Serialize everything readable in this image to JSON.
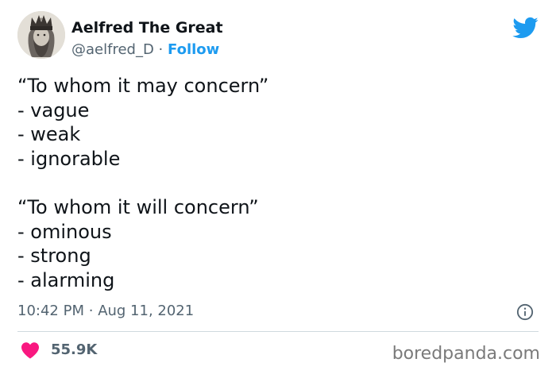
{
  "author": {
    "display_name": "Aelfred The Great",
    "handle": "@aelfred_D",
    "separator": "·",
    "follow_label": "Follow"
  },
  "tweet": {
    "text": "“To whom it may concern”\n- vague\n- weak\n- ignorable\n\n“To whom it will concern”\n- ominous\n- strong\n- alarming",
    "time": "10:42 PM",
    "separator": "·",
    "date": "Aug 11, 2021"
  },
  "engagement": {
    "likes": "55.9K"
  },
  "watermark": "boredpanda.com",
  "icons": {
    "brand": "twitter-bird-icon",
    "info": "info-icon",
    "like": "heart-icon"
  },
  "colors": {
    "brand_blue": "#1d9bf0",
    "text_primary": "#0f1419",
    "text_secondary": "#536471",
    "heart": "#f91880",
    "divider": "#cfd9de"
  }
}
